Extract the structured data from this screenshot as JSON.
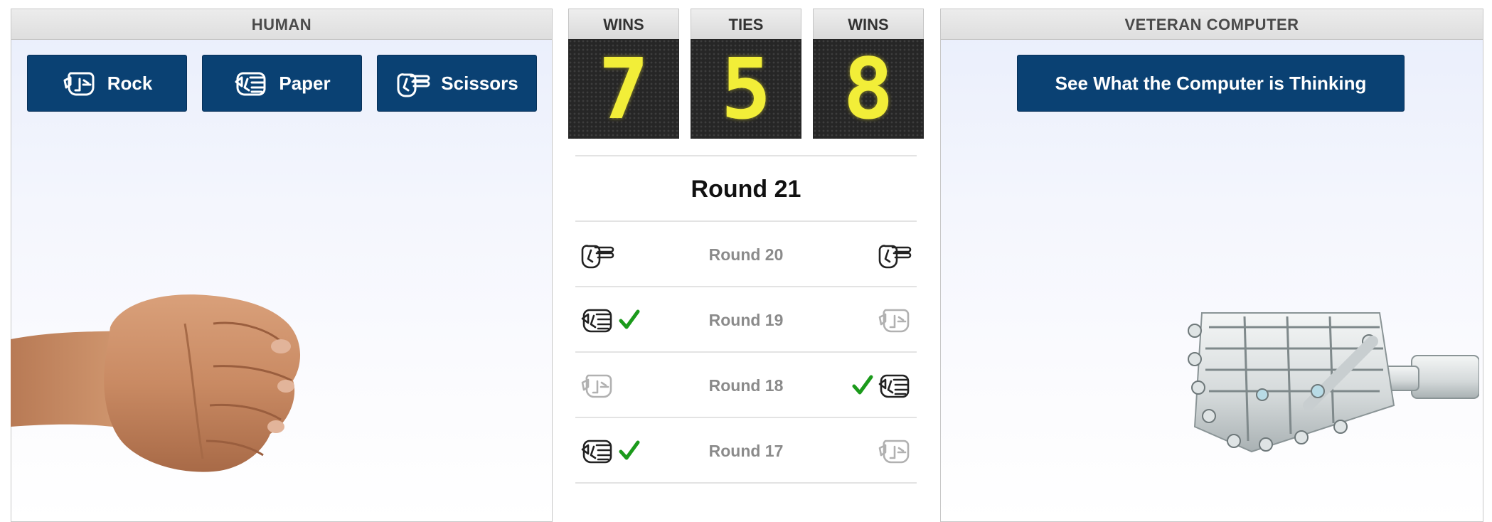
{
  "human_panel": {
    "title": "HUMAN",
    "buttons": [
      {
        "label": "Rock",
        "icon": "rock-hand-icon"
      },
      {
        "label": "Paper",
        "icon": "paper-hand-icon"
      },
      {
        "label": "Scissors",
        "icon": "scissors-hand-icon"
      }
    ]
  },
  "computer_panel": {
    "title": "VETERAN COMPUTER",
    "think_button": "See What the Computer is Thinking"
  },
  "scoreboard": {
    "human_wins_label": "WINS",
    "human_wins": "7",
    "ties_label": "TIES",
    "ties": "5",
    "computer_wins_label": "WINS",
    "computer_wins": "8",
    "digit_color": "#f2ee38"
  },
  "current_round": "Round 21",
  "history": [
    {
      "label": "Round 20",
      "human": "scissors",
      "computer": "scissors",
      "winner": "tie"
    },
    {
      "label": "Round 19",
      "human": "paper",
      "computer": "rock",
      "winner": "human"
    },
    {
      "label": "Round 18",
      "human": "rock",
      "computer": "paper",
      "winner": "computer"
    },
    {
      "label": "Round 17",
      "human": "paper",
      "computer": "rock",
      "winner": "human"
    }
  ],
  "colors": {
    "button": "#0a4173",
    "check": "#1b9a1b",
    "history_text": "#8b8b8b"
  }
}
